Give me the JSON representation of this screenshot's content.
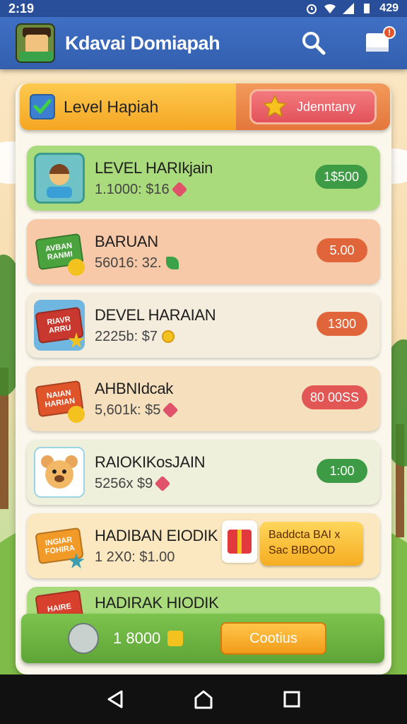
{
  "status_bar": {
    "time": "2:19",
    "battery": "429"
  },
  "app_bar": {
    "title": "Kdavai Domiapah"
  },
  "tabs": {
    "level_label": "Level Hapiah",
    "other_label": "Jdenntany"
  },
  "rewards": [
    {
      "title": "LEVEL HARIkjain",
      "sub": "1.1000: $16",
      "price": "1$500",
      "color": "#a9db7c",
      "price_color": "#3d9b45"
    },
    {
      "title": "BARUAN",
      "sub": "56016: 32.",
      "price": "5.00",
      "color": "#f7c9a8",
      "price_color": "#e1653a",
      "tile_text": "AVBAN RANMI"
    },
    {
      "title": "DEVEL HARAIAN",
      "sub": "2225b: $7",
      "price": "1300",
      "color": "#f4ecdc",
      "price_color": "#e1653a",
      "tile_text": "RIAVR ARRU"
    },
    {
      "title": "AHBNIdcak",
      "sub": "5,601k: $5",
      "price": "80 00SS",
      "color": "#f6dfbd",
      "price_color": "#e25656",
      "tile_text": "NAIAN HARIAN"
    },
    {
      "title": "RAIOKIKosJAIN",
      "sub": "5256x $9",
      "price": "1:00",
      "color": "#eff0dc",
      "price_color": "#3d9b45"
    },
    {
      "title": "HADIBAN EIODIK",
      "sub": "1 2X0: $1.00",
      "color": "#fbe8c0",
      "tile_text": "INGIAR FOHIRA",
      "offer": "Baddcta BAI x\nSac BIBOOD"
    },
    {
      "title": "HADIRAK HIODIK",
      "color": "#a9db7c",
      "tile_text": "HAIRE"
    }
  ],
  "footer": {
    "amount": "1 8000",
    "continue_label": "Cootius"
  }
}
